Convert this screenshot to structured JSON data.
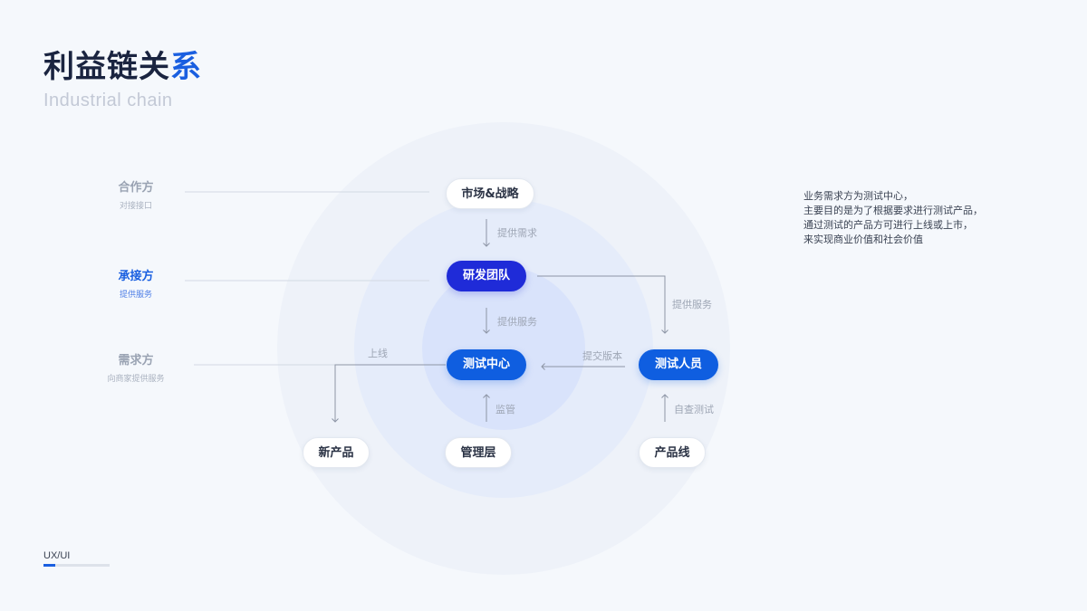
{
  "title": {
    "main": "利益链关",
    "accent": "系"
  },
  "subtitle": "Industrial chain",
  "side_labels": [
    {
      "main": "合作方",
      "sub": "对接接口"
    },
    {
      "main": "承接方",
      "sub": "提供服务"
    },
    {
      "main": "需求方",
      "sub": "向商家提供服务"
    }
  ],
  "nodes": {
    "market": "市场&战略",
    "rd": "研发团队",
    "test_center": "测试中心",
    "tester": "测试人员",
    "new_product": "新产品",
    "management": "管理层",
    "product_line": "产品线"
  },
  "edges": {
    "provide_demand": "提供需求",
    "provide_service_center": "提供服务",
    "provide_service_right": "提供服务",
    "submit_version": "提交版本",
    "launch": "上线",
    "supervise": "监管",
    "self_test": "自查测试"
  },
  "description": [
    "业务需求方为测试中心，",
    "主要目的是为了根据要求进行测试产品，",
    "通过测试的产品方可进行上线或上市，",
    "来实现商业价值和社会价值"
  ],
  "footer": {
    "label": "UX/UI",
    "progress": 0.18
  },
  "colors": {
    "accent": "#1a5fe0",
    "dark_node": "#1f2bd8",
    "blue_node": "#0f5ee0"
  }
}
